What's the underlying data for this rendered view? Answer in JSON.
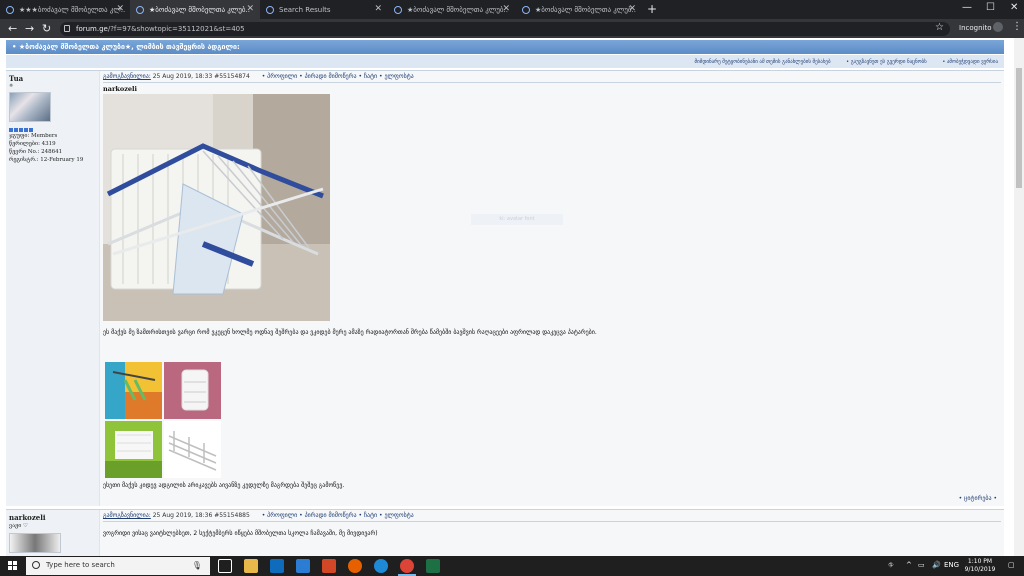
{
  "browser": {
    "tabs": [
      {
        "label": "★★★ბოძავალ მშობელთა კლ.."
      },
      {
        "label": "★ბოძავალ მშობელთა კლუბ.."
      },
      {
        "label": "Search Results"
      },
      {
        "label": "★ბოძავალ მშობელთა კლუბ.."
      },
      {
        "label": "★ბოძავალ მშობელთა კლუბ.."
      }
    ],
    "new_tab": "+",
    "window_controls": [
      "—",
      "☐",
      "✕"
    ],
    "url_domain": "forum.ge",
    "url_rest": "/?f=97&showtopic=35112021&st=405",
    "incognito": "Incognito"
  },
  "forum": {
    "topic_title": "• ★ბოძავალ მშობელთა კლუბი★, ლიმბის თავშეყრის ადგილი:",
    "top_links": [
      "მიმდინარე შეტყობინებანი ამ თემის განახლების შესახებ",
      "• გაუგზავნეთ ეს გვერდი ნაცნობს",
      "• ამობეჭდვადი ვერსია"
    ],
    "watermark": "ki: avatar font",
    "posts": [
      {
        "author": "Tua",
        "star": "✵",
        "group_label": "ჯგუფი: Members",
        "posts_label": "წერილები: 4319",
        "member_no": "წევრი No.: 248641",
        "registered": "რეგისტრ.: 12-February 19",
        "posted_label": "გამოგზავნილია:",
        "date": "25 Aug 2019, 18:33",
        "post_no": "#55154874",
        "links": "• პროფილი • პირადი მიმოწერა • ჩატი • ელფოსტა",
        "quote_author": "narkozeli",
        "body": "ეს მაქვს მე ზამთრისთვის ვარცი რომ ვკეცენ ხოლმე ოდნავ შეშრება და ვკიდებ მერე ამაზე რადიატორთან შრება წამებში ბავშვის რაღაცეები აფრილად დაკეცვა პატარები.",
        "body2": "ესეთი მაქვს კიდევ ადგილის არიკავებს აივანზე კედელზე მაგრდება შეშეც გამოწევ.",
        "quote_link": "• ციტირება •"
      },
      {
        "author": "narkozeli",
        "badge": "ვაჟი ♡",
        "posted_label": "გამოგზავნილია:",
        "date": "25 Aug 2019, 18:36",
        "post_no": "#55154885",
        "links": "• პროფილი • პირადი მიმოწერა • ჩატი • ელფოსტა",
        "body": "ვოგრიდი ვისაც ვაიტსლებსეთ, 2 სექტემბერს იწყება მშობელთა სკოლა ჩამავაში, მე მივდივარ)"
      }
    ]
  },
  "taskbar": {
    "search_placeholder": "Type here to search",
    "lang": "ENG",
    "time": "1:10 PM",
    "date": "9/10/2019"
  }
}
